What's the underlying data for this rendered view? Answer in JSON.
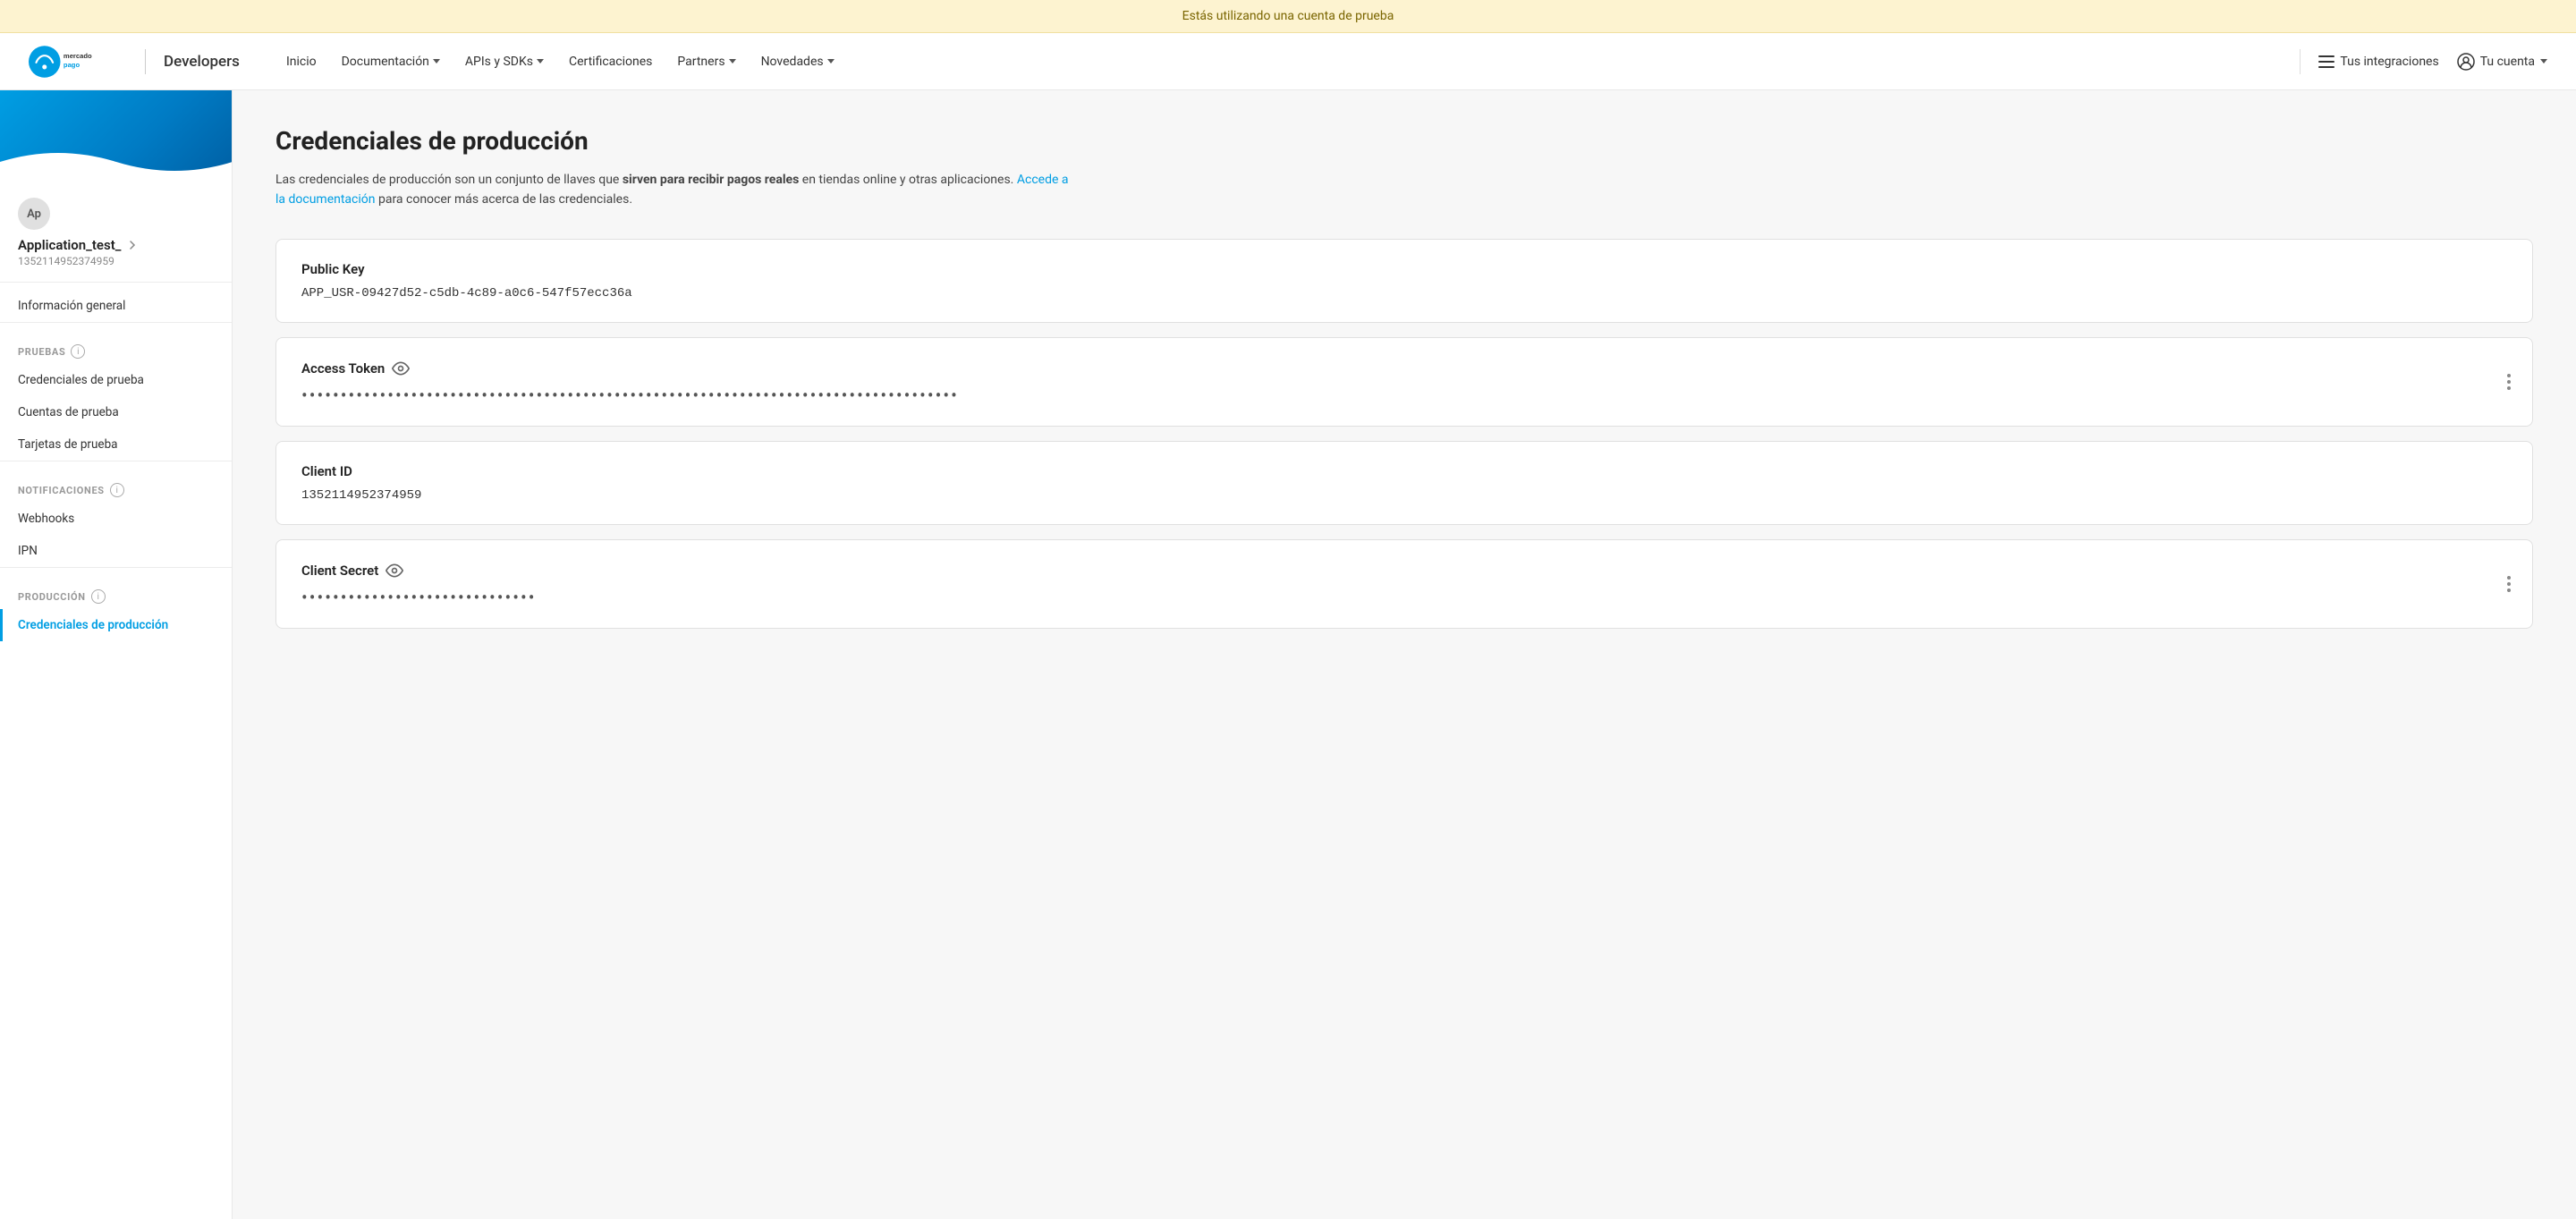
{
  "banner": {
    "text": "Estás utilizando una cuenta de prueba"
  },
  "header": {
    "logo_alt": "Mercado Pago",
    "developers_label": "Developers",
    "nav": [
      {
        "label": "Inicio",
        "has_dropdown": false
      },
      {
        "label": "Documentación",
        "has_dropdown": true
      },
      {
        "label": "APIs y SDKs",
        "has_dropdown": true
      },
      {
        "label": "Certificaciones",
        "has_dropdown": false
      },
      {
        "label": "Partners",
        "has_dropdown": true
      },
      {
        "label": "Novedades",
        "has_dropdown": true
      }
    ],
    "tus_integraciones": "Tus integraciones",
    "tu_cuenta": "Tu cuenta"
  },
  "sidebar": {
    "app_avatar": "Ap",
    "app_name": "Application_test_",
    "app_id": "1352114952374959",
    "info_general_label": "Información general",
    "section_pruebas": "PRUEBAS",
    "pruebas_items": [
      "Credenciales de prueba",
      "Cuentas de prueba",
      "Tarjetas de prueba"
    ],
    "section_notificaciones": "NOTIFICACIONES",
    "notificaciones_items": [
      "Webhooks",
      "IPN"
    ],
    "section_produccion": "PRODUCCIÓN",
    "produccion_items": [
      "Credenciales de producción"
    ]
  },
  "main": {
    "title": "Credenciales de producción",
    "description_part1": "Las credenciales de producción son un conjunto de llaves que ",
    "description_bold": "sirven para recibir pagos reales",
    "description_part2": " en tiendas online y otras aplicaciones. ",
    "description_link": "Accede a la documentación",
    "description_part3": " para conocer más acerca de las credenciales.",
    "credentials": [
      {
        "label": "Public Key",
        "has_eye": false,
        "has_more": false,
        "value": "APP_USR-09427d52-c5db-4c89-a0c6-547f57ecc36a",
        "masked": false
      },
      {
        "label": "Access Token",
        "has_eye": true,
        "has_more": true,
        "value": "••••••••••••••••••••••••••••••••••••••••••••••••••••••••••••••••••••••••••••••••••••",
        "masked": true
      },
      {
        "label": "Client ID",
        "has_eye": false,
        "has_more": false,
        "value": "1352114952374959",
        "masked": false
      },
      {
        "label": "Client Secret",
        "has_eye": true,
        "has_more": true,
        "value": "••••••••••••••••••••••••••••••",
        "masked": true
      }
    ]
  }
}
